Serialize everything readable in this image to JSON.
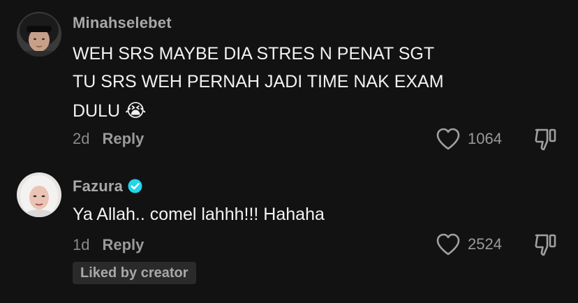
{
  "comments": [
    {
      "username": "Minahselebet",
      "lines": [
        "WEH SRS MAYBE DIA STRES N PENAT SGT",
        "TU SRS WEH PERNAH JADI TIME NAK EXAM",
        "DULU"
      ],
      "emoji": "😭",
      "age": "2d",
      "reply_label": "Reply",
      "likes": "1064",
      "avatar_icon": "user-avatar-helmet",
      "verified": false
    },
    {
      "username": "Fazura",
      "lines": [
        "Ya Allah.. comel lahhh!!! Hahaha"
      ],
      "age": "1d",
      "reply_label": "Reply",
      "likes": "2524",
      "avatar_icon": "user-avatar-hijab",
      "verified": true,
      "badge": "Liked by creator"
    }
  ],
  "colors": {
    "background": "#121212",
    "verified": "#20d5ec",
    "username": "#a8a8a8",
    "meta": "#8a8a8a"
  }
}
